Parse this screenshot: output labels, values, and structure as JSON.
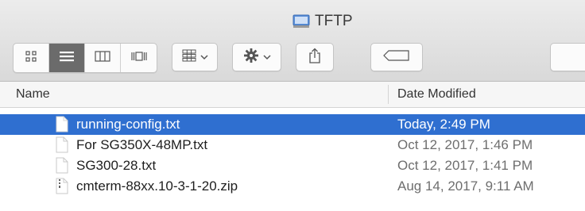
{
  "window": {
    "title": "TFTP",
    "title_icon": "folder-drive-icon"
  },
  "toolbar": {
    "view_buttons": [
      {
        "icon": "icon-view-icon",
        "active": false
      },
      {
        "icon": "list-view-icon",
        "active": true
      },
      {
        "icon": "column-view-icon",
        "active": false
      },
      {
        "icon": "gallery-view-icon",
        "active": false
      }
    ],
    "group_button": {
      "icon": "group-icon",
      "chevron": "chevron-down-icon"
    },
    "action_button": {
      "icon": "gear-icon",
      "chevron": "chevron-down-icon"
    },
    "share_button": {
      "icon": "share-icon"
    },
    "tags_button": {
      "icon": "tag-icon"
    }
  },
  "columns": {
    "name": "Name",
    "date_modified": "Date Modified"
  },
  "files": [
    {
      "name": "running-config.txt",
      "date": "Today, 2:49 PM",
      "icon": "text-file-icon",
      "selected": true
    },
    {
      "name": "For SG350X-48MP.txt",
      "date": "Oct 12, 2017, 1:46 PM",
      "icon": "text-file-icon",
      "selected": false
    },
    {
      "name": "SG300-28.txt",
      "date": "Oct 12, 2017, 1:41 PM",
      "icon": "text-file-icon",
      "selected": false
    },
    {
      "name": "cmterm-88xx.10-3-1-20.zip",
      "date": "Aug 14, 2017, 9:11 AM",
      "icon": "zip-file-icon",
      "selected": false
    }
  ],
  "colors": {
    "selection": "#2f6fd0",
    "active_view_button": "#6b6b6b"
  }
}
